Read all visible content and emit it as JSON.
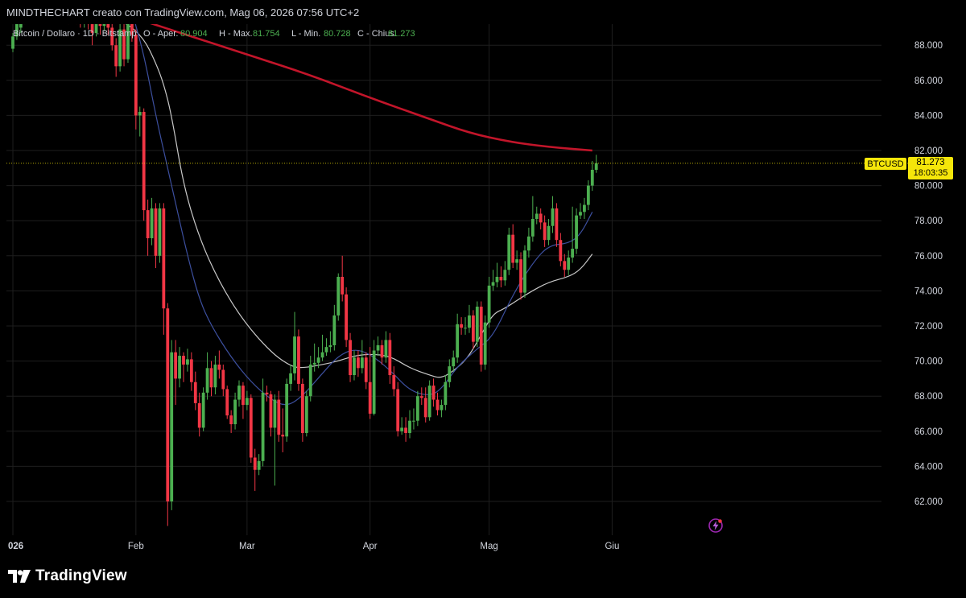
{
  "header": {
    "creator_line": "MINDTHECHART creato con TradingView.com, Mag 06, 2026 07:56 UTC+2"
  },
  "legend": {
    "symbol": "Bitcoin / Dollaro · 1D · Bitstamp",
    "open_label": "O - Aper.",
    "open_value": "80.904",
    "high_label": "H - Max.",
    "high_value": "81.754",
    "low_label": "L - Min.",
    "low_value": "80.728",
    "close_label": "C - Chius.",
    "close_value": "81.273"
  },
  "badges": {
    "symbol": "BTCUSD",
    "last_price": "81.273",
    "countdown": "18:03:35"
  },
  "footer": {
    "brand": "TradingView"
  },
  "colors": {
    "background": "#000000",
    "up": "#4caf50",
    "down": "#f23645",
    "grid": "#1e1e1e",
    "ma200": "#c2152a",
    "ma_white": "#c8c8c8",
    "ma_blue": "#3c4f9e",
    "badge": "#f5e60a",
    "legend_value": "#4caf50"
  },
  "icons": {
    "alert": "lightning-alert-icon",
    "logo": "tradingview-logo-icon"
  },
  "chart_data": {
    "type": "candlestick",
    "x_ticks": [
      "026",
      "Feb",
      "Mar",
      "Apr",
      "Mag",
      "Giu"
    ],
    "y_ticks": [
      "62.000",
      "64.000",
      "66.000",
      "68.000",
      "70.000",
      "72.000",
      "74.000",
      "76.000",
      "78.000",
      "80.000",
      "82.000",
      "84.000",
      "86.000",
      "88.000"
    ],
    "ylim": [
      61000,
      89500
    ],
    "grid": true,
    "start_date": "2026-01-01",
    "candles": [
      [
        87800,
        88500,
        87600,
        88700
      ],
      [
        88500,
        89400,
        88300,
        89600
      ],
      [
        89000,
        89600,
        88700,
        89900
      ],
      [
        89500,
        89800,
        89200,
        90000
      ],
      [
        89800,
        89700,
        89400,
        90100
      ],
      [
        89700,
        89900,
        89500,
        90200
      ],
      [
        89900,
        89800,
        89500,
        90300
      ],
      [
        89800,
        90000,
        89600,
        90300
      ],
      [
        90000,
        89800,
        89500,
        90200
      ],
      [
        89800,
        89600,
        89300,
        90100
      ],
      [
        89600,
        89900,
        89400,
        90200
      ],
      [
        89900,
        89700,
        89400,
        90100
      ],
      [
        89700,
        89900,
        89500,
        90200
      ],
      [
        89900,
        89700,
        89300,
        90100
      ],
      [
        89700,
        89500,
        89200,
        90000
      ],
      [
        89500,
        89700,
        89300,
        90000
      ],
      [
        89700,
        89500,
        89200,
        89900
      ],
      [
        89500,
        89300,
        89000,
        89800
      ],
      [
        89300,
        89400,
        89000,
        89700
      ],
      [
        89400,
        89200,
        88900,
        89700
      ],
      [
        89200,
        88700,
        88000,
        89500
      ],
      [
        88700,
        89400,
        88500,
        89700
      ],
      [
        89400,
        89100,
        88600,
        89600
      ],
      [
        89100,
        89300,
        88800,
        89600
      ],
      [
        89300,
        89000,
        88600,
        89500
      ],
      [
        89000,
        88000,
        87700,
        89300
      ],
      [
        88000,
        86800,
        86200,
        88400
      ],
      [
        86800,
        88900,
        86500,
        89300
      ],
      [
        88900,
        87200,
        86800,
        89200
      ],
      [
        87200,
        89700,
        87000,
        90000
      ],
      [
        89700,
        88600,
        88200,
        89900
      ],
      [
        88600,
        84000,
        83200,
        88900
      ],
      [
        84000,
        84200,
        82800,
        84500
      ],
      [
        84200,
        78600,
        78000,
        84400
      ],
      [
        78600,
        77000,
        76000,
        79200
      ],
      [
        77000,
        78700,
        76600,
        79300
      ],
      [
        78700,
        76000,
        75300,
        79000
      ],
      [
        76000,
        78700,
        75600,
        79000
      ],
      [
        78700,
        73000,
        71500,
        79000
      ],
      [
        73000,
        62000,
        60600,
        73300
      ],
      [
        62000,
        70500,
        61500,
        71200
      ],
      [
        70500,
        69000,
        67500,
        71200
      ],
      [
        69000,
        70300,
        68500,
        70800
      ],
      [
        70300,
        69800,
        68800,
        70500
      ],
      [
        69800,
        70100,
        69400,
        70700
      ],
      [
        70100,
        68800,
        68300,
        70500
      ],
      [
        68800,
        67600,
        67200,
        69400
      ],
      [
        67600,
        66200,
        65700,
        68200
      ],
      [
        66200,
        68200,
        66000,
        68500
      ],
      [
        68200,
        69600,
        67800,
        70500
      ],
      [
        69600,
        68500,
        68000,
        70000
      ],
      [
        68500,
        69800,
        68100,
        70300
      ],
      [
        69800,
        69500,
        69000,
        70600
      ],
      [
        69500,
        68400,
        68000,
        69800
      ],
      [
        68400,
        66900,
        66700,
        68600
      ],
      [
        66900,
        66400,
        65900,
        67200
      ],
      [
        66400,
        67800,
        66100,
        68200
      ],
      [
        67800,
        68600,
        67400,
        68900
      ],
      [
        68600,
        67500,
        66700,
        68800
      ],
      [
        67500,
        67900,
        67200,
        68300
      ],
      [
        67900,
        64500,
        64200,
        68100
      ],
      [
        64500,
        63800,
        62600,
        65000
      ],
      [
        63800,
        64300,
        63500,
        64700
      ],
      [
        64300,
        68200,
        64000,
        69000
      ],
      [
        68200,
        68100,
        67700,
        68600
      ],
      [
        68100,
        66200,
        65700,
        68300
      ],
      [
        66200,
        67800,
        62900,
        68100
      ],
      [
        67800,
        65800,
        65400,
        68300
      ],
      [
        65800,
        65700,
        64800,
        67300
      ],
      [
        65700,
        68700,
        65400,
        69000
      ],
      [
        68700,
        69300,
        68300,
        69800
      ],
      [
        69300,
        71400,
        68900,
        72800
      ],
      [
        71400,
        68700,
        68300,
        71800
      ],
      [
        68700,
        65900,
        65400,
        69000
      ],
      [
        65900,
        68000,
        65700,
        68300
      ],
      [
        68000,
        69800,
        67700,
        70300
      ],
      [
        69800,
        69900,
        69400,
        71000
      ],
      [
        69900,
        70200,
        69600,
        70800
      ],
      [
        70200,
        70500,
        70000,
        71500
      ],
      [
        70500,
        70800,
        70300,
        71300
      ],
      [
        70800,
        70900,
        70500,
        71700
      ],
      [
        70900,
        72600,
        70600,
        73200
      ],
      [
        72600,
        74800,
        72300,
        75000
      ],
      [
        74800,
        73800,
        73400,
        76000
      ],
      [
        73800,
        71200,
        70800,
        74200
      ],
      [
        71200,
        69200,
        68800,
        71600
      ],
      [
        69200,
        70200,
        68900,
        70600
      ],
      [
        70200,
        69600,
        69100,
        70600
      ],
      [
        69600,
        70200,
        69300,
        71200
      ],
      [
        70200,
        68800,
        68400,
        70500
      ],
      [
        68800,
        67000,
        66700,
        70800
      ],
      [
        67000,
        70600,
        66900,
        71200
      ],
      [
        70600,
        70900,
        70300,
        71400
      ],
      [
        70900,
        70200,
        69800,
        71200
      ],
      [
        70200,
        71200,
        69900,
        71700
      ],
      [
        71200,
        69200,
        68700,
        71600
      ],
      [
        69200,
        68400,
        68000,
        69700
      ],
      [
        68400,
        66000,
        65700,
        68800
      ],
      [
        66000,
        66200,
        65800,
        66800
      ],
      [
        66200,
        65900,
        65400,
        66800
      ],
      [
        65900,
        66600,
        65600,
        67200
      ],
      [
        66600,
        66600,
        66100,
        67300
      ],
      [
        66600,
        68000,
        66300,
        68300
      ],
      [
        68000,
        67900,
        67500,
        68500
      ],
      [
        67900,
        66800,
        66500,
        68500
      ],
      [
        66800,
        68600,
        66600,
        68900
      ],
      [
        68600,
        67800,
        67400,
        69000
      ],
      [
        67800,
        67200,
        66900,
        68200
      ],
      [
        67200,
        67500,
        66800,
        67800
      ],
      [
        67500,
        68800,
        67200,
        69200
      ],
      [
        68800,
        69700,
        68500,
        70100
      ],
      [
        69700,
        70200,
        69400,
        70600
      ],
      [
        70200,
        72100,
        69900,
        72700
      ],
      [
        72100,
        71900,
        71500,
        72500
      ],
      [
        71900,
        71900,
        71500,
        72500
      ],
      [
        71900,
        72600,
        71600,
        73200
      ],
      [
        72600,
        71100,
        70700,
        72900
      ],
      [
        71100,
        73100,
        70800,
        73400
      ],
      [
        73100,
        69800,
        69400,
        73400
      ],
      [
        69800,
        72200,
        69500,
        72600
      ],
      [
        72200,
        74300,
        71900,
        74800
      ],
      [
        74300,
        74500,
        74000,
        75200
      ],
      [
        74500,
        74800,
        74200,
        75600
      ],
      [
        74800,
        74600,
        74200,
        75400
      ],
      [
        74600,
        75200,
        74300,
        75700
      ],
      [
        75200,
        77200,
        74900,
        77600
      ],
      [
        77200,
        75600,
        75300,
        77800
      ],
      [
        75600,
        75800,
        75200,
        76300
      ],
      [
        75800,
        73900,
        73500,
        76200
      ],
      [
        73900,
        76300,
        73600,
        76600
      ],
      [
        76300,
        77100,
        75900,
        77600
      ],
      [
        77100,
        78100,
        76800,
        79400
      ],
      [
        78100,
        78400,
        77800,
        78800
      ],
      [
        78400,
        77900,
        77500,
        78700
      ],
      [
        77900,
        76900,
        76500,
        78300
      ],
      [
        76900,
        77700,
        76600,
        78100
      ],
      [
        77700,
        78700,
        77300,
        79400
      ],
      [
        78700,
        76900,
        76500,
        79000
      ],
      [
        76900,
        75700,
        75400,
        77300
      ],
      [
        75700,
        75200,
        74800,
        76100
      ],
      [
        75200,
        75900,
        74900,
        76300
      ],
      [
        75900,
        76400,
        75600,
        78800
      ],
      [
        76400,
        78300,
        76100,
        78700
      ],
      [
        78300,
        78500,
        78100,
        79000
      ],
      [
        78500,
        78900,
        78100,
        79300
      ],
      [
        78900,
        80000,
        78600,
        80300
      ],
      [
        80000,
        80900,
        79700,
        81400
      ],
      [
        80900,
        81273,
        80728,
        81754
      ]
    ],
    "moving_averages": [
      {
        "color": "ma200",
        "points": [
          [
            -10,
            91900
          ],
          [
            0,
            91400
          ],
          [
            15,
            90600
          ],
          [
            30,
            89600
          ],
          [
            45,
            88500
          ],
          [
            60,
            87400
          ],
          [
            75,
            86300
          ],
          [
            90,
            85000
          ],
          [
            105,
            83800
          ],
          [
            115,
            83000
          ],
          [
            125,
            82500
          ],
          [
            135,
            82200
          ],
          [
            146,
            82000
          ]
        ]
      },
      {
        "color": "ma_white",
        "points": [
          [
            0,
            89500
          ],
          [
            20,
            89700
          ],
          [
            28,
            89400
          ],
          [
            33,
            88400
          ],
          [
            36,
            87000
          ],
          [
            38,
            85800
          ],
          [
            40,
            84000
          ],
          [
            43,
            80000
          ],
          [
            47,
            77000
          ],
          [
            52,
            74500
          ],
          [
            58,
            72300
          ],
          [
            65,
            70500
          ],
          [
            70,
            69700
          ],
          [
            73,
            69600
          ],
          [
            78,
            69800
          ],
          [
            82,
            70000
          ],
          [
            86,
            70300
          ],
          [
            90,
            70400
          ],
          [
            95,
            70300
          ],
          [
            100,
            69600
          ],
          [
            105,
            69200
          ],
          [
            108,
            69000
          ],
          [
            112,
            69600
          ],
          [
            115,
            70300
          ],
          [
            118,
            71500
          ],
          [
            121,
            72700
          ],
          [
            124,
            73000
          ],
          [
            130,
            73900
          ],
          [
            135,
            74500
          ],
          [
            140,
            74800
          ],
          [
            143,
            75200
          ],
          [
            146,
            76100
          ]
        ]
      },
      {
        "color": "ma_blue",
        "points": [
          [
            30,
            89900
          ],
          [
            33,
            87500
          ],
          [
            36,
            84000
          ],
          [
            39,
            81000
          ],
          [
            41,
            79000
          ],
          [
            44,
            76000
          ],
          [
            47,
            73500
          ],
          [
            50,
            72000
          ],
          [
            55,
            70200
          ],
          [
            60,
            68800
          ],
          [
            65,
            67800
          ],
          [
            69,
            67400
          ],
          [
            73,
            68000
          ],
          [
            78,
            69300
          ],
          [
            82,
            70300
          ],
          [
            86,
            70700
          ],
          [
            90,
            70400
          ],
          [
            95,
            69500
          ],
          [
            100,
            68300
          ],
          [
            105,
            68000
          ],
          [
            108,
            68400
          ],
          [
            112,
            69700
          ],
          [
            117,
            70700
          ],
          [
            121,
            71400
          ],
          [
            126,
            73800
          ],
          [
            131,
            75600
          ],
          [
            135,
            76600
          ],
          [
            140,
            76700
          ],
          [
            143,
            77200
          ],
          [
            146,
            78500
          ]
        ]
      }
    ]
  }
}
